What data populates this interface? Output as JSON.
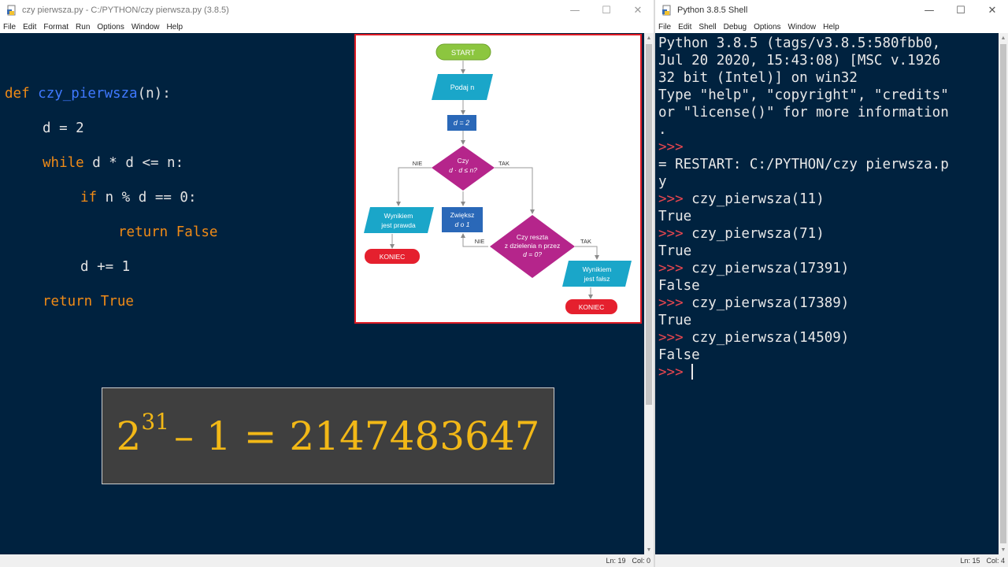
{
  "editor": {
    "title": "czy pierwsza.py - C:/PYTHON/czy pierwsza.py (3.8.5)",
    "menu": [
      "File",
      "Edit",
      "Format",
      "Run",
      "Options",
      "Window",
      "Help"
    ],
    "status": {
      "line": "Ln: 19",
      "col": "Col: 0"
    },
    "code": {
      "l1_def": "def",
      "l1_name": "czy_pierwsza",
      "l1_rest": "(n):",
      "l2": "d = 2",
      "l3_kw": "while",
      "l3_rest": " d * d <= n:",
      "l4_kw": "if",
      "l4_rest": " n % d == 0:",
      "l5": "return False",
      "l6": "d += 1",
      "l7": "return True"
    }
  },
  "flowchart": {
    "start": "START",
    "input": "Podaj n",
    "init": "d = 2",
    "decision1_line1": "Czy",
    "decision1_line2": "d · d ≤ n?",
    "nie1": "NIE",
    "tak1": "TAK",
    "output_true_line1": "Wynikiem",
    "output_true_line2": "jest  prawda",
    "end1": "KONIEC",
    "increment_line1": "Zwiększ",
    "increment_line2": "d o 1",
    "decision2_line1": "Czy reszta",
    "decision2_line2": "z dzielenia n przez",
    "decision2_line3": "d = 0?",
    "nie2": "NIE",
    "tak2": "TAK",
    "output_false_line1": "Wynikiem",
    "output_false_line2": "jest fałsz",
    "end2": "KONIEC"
  },
  "formula": {
    "base": "2",
    "exponent": "31",
    "rest": "– 1 = 2147483647"
  },
  "shell": {
    "title": "Python 3.8.5 Shell",
    "menu": [
      "File",
      "Edit",
      "Shell",
      "Debug",
      "Options",
      "Window",
      "Help"
    ],
    "status": {
      "line": "Ln: 15",
      "col": "Col: 4"
    },
    "banner": [
      "Python 3.8.5 (tags/v3.8.5:580fbb0,",
      "Jul 20 2020, 15:43:08) [MSC v.1926",
      "32 bit (Intel)] on win32",
      "Type \"help\", \"copyright\", \"credits\"",
      "or \"license()\" for more information",
      "."
    ],
    "prompt": ">>> ",
    "restart": [
      "= RESTART: C:/PYTHON/czy pierwsza.p",
      "y"
    ],
    "session": [
      {
        "cmd": "czy_pierwsza(11)",
        "out": "True"
      },
      {
        "cmd": "czy_pierwsza(71)",
        "out": "True"
      },
      {
        "cmd": "czy_pierwsza(17391)",
        "out": "False"
      },
      {
        "cmd": "czy_pierwsza(17389)",
        "out": "True"
      },
      {
        "cmd": "czy_pierwsza(14509)",
        "out": "False"
      }
    ]
  }
}
